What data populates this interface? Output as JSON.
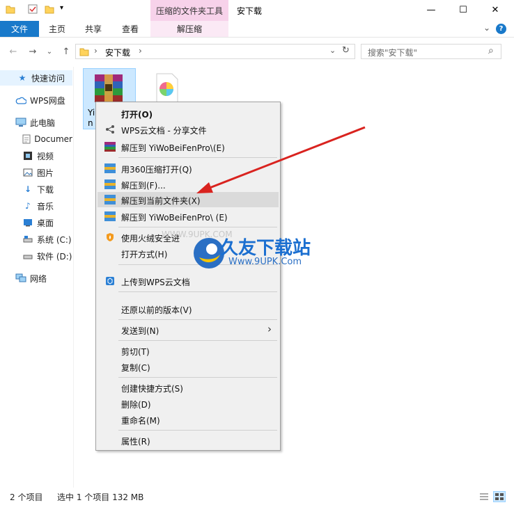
{
  "title_bar": {
    "context_tab_header": "压缩的文件夹工具",
    "window_title": "安下载",
    "minimize_glyph": "—",
    "maximize_glyph": "☐",
    "close_glyph": "✕",
    "qat_dropdown_glyph": "▾"
  },
  "ribbon": {
    "tabs": [
      {
        "label": "文件"
      },
      {
        "label": "主页"
      },
      {
        "label": "共享"
      },
      {
        "label": "查看"
      },
      {
        "label": "解压缩"
      }
    ],
    "expand_glyph": "⌄",
    "help_glyph": "?"
  },
  "address_bar": {
    "back_glyph": "←",
    "forward_glyph": "→",
    "recent_glyph": "⌄",
    "up_glyph": "↑",
    "path": "安下载",
    "separator_glyph": "›",
    "dropdown_glyph": "⌄",
    "refresh_glyph": "↻",
    "search_placeholder": "搜索\"安下载\"",
    "search_glyph": "⌕"
  },
  "sidebar": {
    "items": [
      {
        "label": "快速访问",
        "icon": "star-icon"
      },
      {
        "label": "WPS网盘",
        "icon": "cloud-icon"
      },
      {
        "label": "此电脑",
        "icon": "computer-icon"
      },
      {
        "label": "Documer",
        "icon": "document-icon"
      },
      {
        "label": "视频",
        "icon": "video-icon"
      },
      {
        "label": "图片",
        "icon": "picture-icon"
      },
      {
        "label": "下载",
        "icon": "download-icon"
      },
      {
        "label": "音乐",
        "icon": "music-icon"
      },
      {
        "label": "桌面",
        "icon": "desktop-icon"
      },
      {
        "label": "系统 (C:)",
        "icon": "drive-icon"
      },
      {
        "label": "软件 (D:)",
        "icon": "drive-icon"
      },
      {
        "label": "网络",
        "icon": "network-icon"
      }
    ]
  },
  "files": {
    "selected_label_line1": "Yi",
    "selected_label_line2": "n"
  },
  "context_menu": {
    "items": [
      {
        "label": "打开(O)",
        "icon": ""
      },
      {
        "label": "WPS云文档 - 分享文件",
        "icon": "share-icon"
      },
      {
        "label": "解压到 YiWoBeiFenPro\\(E)",
        "icon": "winrar-icon"
      },
      {
        "label": "用360压缩打开(Q)",
        "icon": "archive-360-icon"
      },
      {
        "label": "解压到(F)...",
        "icon": "archive-360-icon"
      },
      {
        "label": "解压到当前文件夹(X)",
        "icon": "archive-360-icon"
      },
      {
        "label": "解压到 YiWoBeiFenPro\\ (E)",
        "icon": "archive-360-icon"
      },
      {
        "label": "使用火绒安全进",
        "icon": "huorong-icon"
      },
      {
        "label": "打开方式(H)",
        "icon": ""
      },
      {
        "label": "上传到WPS云文档",
        "icon": "wps-cloud-icon"
      },
      {
        "label": "还原以前的版本(V)",
        "icon": ""
      },
      {
        "label": "发送到(N)",
        "icon": ""
      },
      {
        "label": "剪切(T)",
        "icon": ""
      },
      {
        "label": "复制(C)",
        "icon": ""
      },
      {
        "label": "创建快捷方式(S)",
        "icon": ""
      },
      {
        "label": "删除(D)",
        "icon": ""
      },
      {
        "label": "重命名(M)",
        "icon": ""
      },
      {
        "label": "属性(R)",
        "icon": ""
      }
    ],
    "submenu_glyph": "›"
  },
  "watermark": {
    "brand": "久友下载站",
    "url": "Www.9UPK.Com",
    "faint_url": "WWW.9UPK.COM"
  },
  "status_bar": {
    "item_count": "2 个项目",
    "selection": "选中 1 个项目  132 MB"
  },
  "colors": {
    "accent": "#1979ca",
    "context_tab": "#f7d2ea",
    "arrow": "#d9231f"
  }
}
